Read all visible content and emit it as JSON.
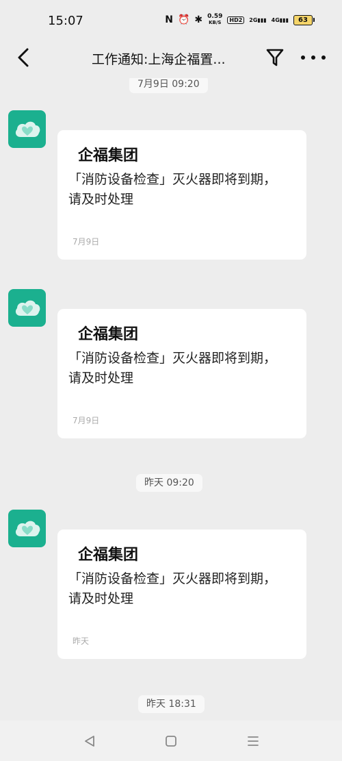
{
  "status_bar": {
    "time": "15:07",
    "nfc": "N",
    "alarm": "⏰",
    "bluetooth": "✱",
    "net_speed": "0.59",
    "net_unit": "KB/S",
    "hd": "HD2",
    "sig1": "2G",
    "sig2": "4G",
    "battery": "63"
  },
  "nav": {
    "title": "工作通知:上海企福置..."
  },
  "messages": [
    {
      "time_label": "7月9日 09:20",
      "sender": "企福集团",
      "body": "「消防设备检查」灭火器即将到期，请及时处理",
      "date": "7月9日"
    },
    {
      "sender": "企福集团",
      "body": "「消防设备检查」灭火器即将到期，请及时处理",
      "date": "7月9日"
    },
    {
      "time_label": "昨天 09:20",
      "sender": "企福集团",
      "body": "「消防设备检查」灭火器即将到期，请及时处理",
      "date": "昨天"
    },
    {
      "time_label": "昨天 18:31"
    }
  ],
  "colors": {
    "background": "#ededed",
    "avatar": "#1bb08f",
    "card": "#ffffff"
  }
}
